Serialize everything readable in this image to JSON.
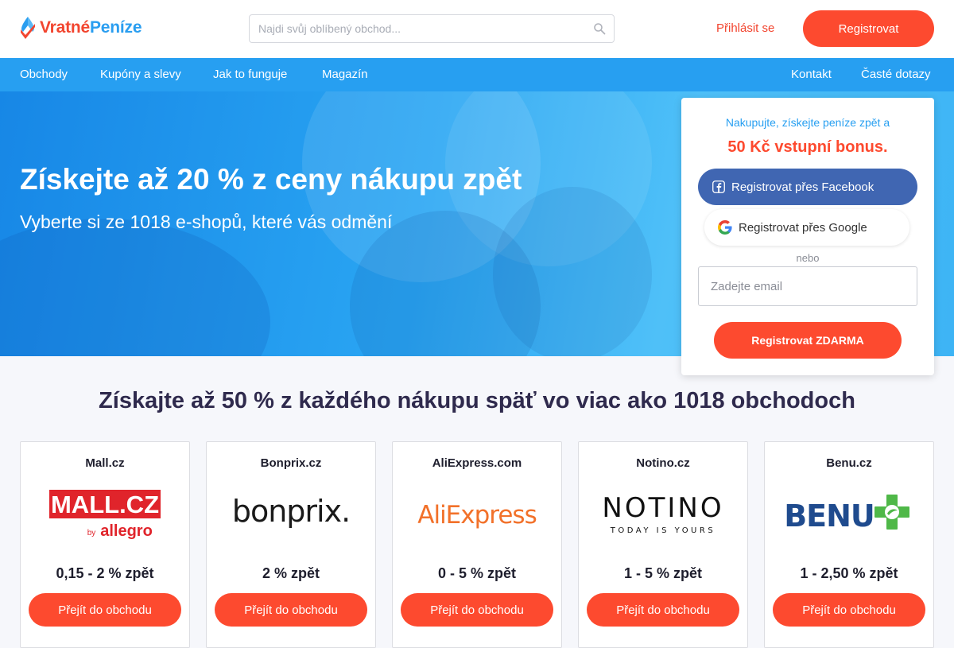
{
  "brand": {
    "part1": "Vratné",
    "part2": "Peníze"
  },
  "search": {
    "placeholder": "Najdi svůj oblíbený obchod..."
  },
  "header": {
    "login_label": "Přihlásit se",
    "register_label": "Registrovat"
  },
  "nav": {
    "left": [
      "Obchody",
      "Kupóny a slevy",
      "Jak to funguje",
      "Magazín"
    ],
    "right": [
      "Kontakt",
      "Časté dotazy"
    ]
  },
  "hero": {
    "title": "Získejte až 20 % z ceny nákupu zpět",
    "subtitle": "Vyberte si ze 1018 e-shopů, které vás odmění"
  },
  "signup": {
    "line1": "Nakupujte, získejte peníze zpět a",
    "line2": "50 Kč vstupní bonus.",
    "facebook_label": "Registrovat přes Facebook",
    "google_label": "Registrovat přes Google",
    "or_label": "nebo",
    "email_placeholder": "Zadejte email",
    "submit_label": "Registrovat ZDARMA"
  },
  "section": {
    "title": "Získajte až 50 % z každého nákupu späť vo viac ako 1018 obchodoch"
  },
  "shops": [
    {
      "name": "Mall.cz",
      "logo_text": "MALL.CZ",
      "logo_sub": "allegro",
      "logo_by": "by",
      "rate": "0,15 - 2 % zpět",
      "button": "Přejít do obchodu"
    },
    {
      "name": "Bonprix.cz",
      "logo_text": "bonprix.",
      "rate": "2 % zpět",
      "button": "Přejít do obchodu"
    },
    {
      "name": "AliExpress.com",
      "logo_text": "AliExpress",
      "rate": "0 - 5 % zpět",
      "button": "Přejít do obchodu"
    },
    {
      "name": "Notino.cz",
      "logo_text": "NOTINO",
      "logo_sub": "TODAY IS YOURS",
      "rate": "1 - 5 % zpět",
      "button": "Přejít do obchodu"
    },
    {
      "name": "Benu.cz",
      "logo_text": "BENU",
      "rate": "1 - 2,50 % zpět",
      "button": "Přejít do obchodu"
    }
  ],
  "colors": {
    "accent": "#fd4a2f",
    "primary": "#279ff1",
    "facebook": "#4066b2"
  }
}
